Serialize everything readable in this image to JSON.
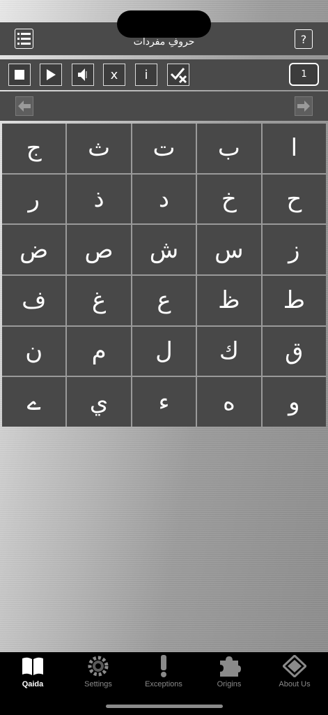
{
  "header": {
    "title": "حروفِ مفردات",
    "menu_icon": "list-icon",
    "help_label": "?"
  },
  "toolbar": {
    "stop_icon": "stop-icon",
    "play_icon": "play-icon",
    "sound_icon": "speaker-icon",
    "x_label": "x",
    "info_label": "i",
    "check_icon": "check-x-icon",
    "page_number": "1"
  },
  "nav": {
    "prev_icon": "arrow-left-icon",
    "next_icon": "arrow-right-icon"
  },
  "letters": [
    "ا",
    "ب",
    "ت",
    "ث",
    "ج",
    "ح",
    "خ",
    "د",
    "ذ",
    "ر",
    "ز",
    "س",
    "ش",
    "ص",
    "ض",
    "ط",
    "ظ",
    "ع",
    "غ",
    "ف",
    "ق",
    "ك",
    "ل",
    "م",
    "ن",
    "و",
    "ه",
    "ء",
    "ي",
    "ے"
  ],
  "tabs": [
    {
      "label": "Qaida",
      "icon": "book-icon",
      "active": true
    },
    {
      "label": "Settings",
      "icon": "gear-icon",
      "active": false
    },
    {
      "label": "Exceptions",
      "icon": "exclamation-icon",
      "active": false
    },
    {
      "label": "Origins",
      "icon": "puzzle-icon",
      "active": false
    },
    {
      "label": "About Us",
      "icon": "diamond-icon",
      "active": false
    }
  ],
  "colors": {
    "bar": "#4a4a4a",
    "cell": "#484848",
    "tabbar": "#000000",
    "active_tab": "#ffffff",
    "inactive_tab": "#8a8a8a"
  }
}
